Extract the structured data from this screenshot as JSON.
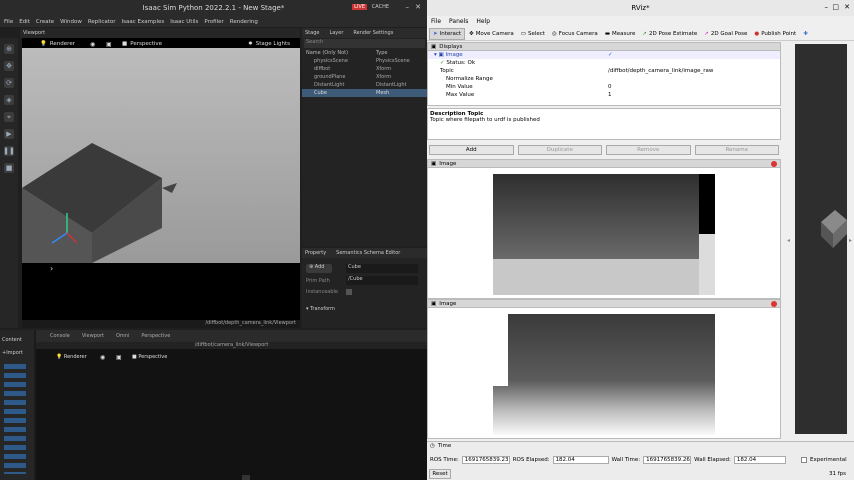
{
  "isaac": {
    "title": "Isaac Sim Python 2022.2.1 - New Stage*",
    "live": "LIVE",
    "cache": "CACHE",
    "menu": [
      "File",
      "Edit",
      "Create",
      "Window",
      "Replicator",
      "Isaac Examples",
      "Isaac Utils",
      "Profiler",
      "Rendering"
    ],
    "viewport_tab": "Viewport",
    "renderer_label": "Renderer",
    "perspective_label": "Perspective",
    "stage_lights_label": "Stage Lights",
    "viewport_path": "/diffbot/depth_camera_link/Viewport",
    "viewport2_tabs": [
      "Console",
      "Viewport",
      "Omni",
      "Perspective"
    ],
    "viewport2_path": "/diffbot/camera_link/Viewport",
    "stage_tabs": [
      "Stage",
      "Layer",
      "Render Settings"
    ],
    "search_placeholder": "Search",
    "stage_cols": [
      "Name (Only Not)",
      "Type"
    ],
    "stage_rows": [
      {
        "name": "physicsScene",
        "type": "PhysicsScene"
      },
      {
        "name": "diffbot",
        "type": "Xform"
      },
      {
        "name": "groundPlane",
        "type": "Xform"
      },
      {
        "name": "DistantLight",
        "type": "DistantLight"
      },
      {
        "name": "Cube",
        "type": "Mesh"
      }
    ],
    "property_tabs": [
      "Property",
      "Semantics Schema Editor"
    ],
    "add_label": "Add",
    "name_value": "Cube",
    "prim_path_label": "Prim Path",
    "prim_path_value": "/Cube",
    "instanceable_label": "Instanceable",
    "transform_label": "Transform",
    "content_label": "Content",
    "import_label": "Import"
  },
  "rviz": {
    "title": "RViz*",
    "menu": [
      "File",
      "Panels",
      "Help"
    ],
    "tools": [
      "Interact",
      "Move Camera",
      "Select",
      "Focus Camera",
      "Measure",
      "2D Pose Estimate",
      "2D Goal Pose",
      "Publish Point"
    ],
    "displays_title": "Displays",
    "props": [
      {
        "name": "Image",
        "value": "✓",
        "indent": 1
      },
      {
        "name": "Status: Ok",
        "value": "",
        "indent": 2
      },
      {
        "name": "Topic",
        "value": "/diffbot/depth_camera_link/image_raw",
        "indent": 2
      },
      {
        "name": "Normalize Range",
        "value": "",
        "indent": 2
      },
      {
        "name": "Min Value",
        "value": "0",
        "indent": 2
      },
      {
        "name": "Max Value",
        "value": "1",
        "indent": 2
      }
    ],
    "desc_title": "Description Topic",
    "desc_text": "Topic where filepath to urdf is published",
    "buttons": [
      "Add",
      "Duplicate",
      "Remove",
      "Rename"
    ],
    "image_panel_1": "Image",
    "image_panel_2": "Image",
    "time_title": "Time",
    "ros_time_label": "ROS Time:",
    "ros_time_value": "1691765839.23",
    "ros_elapsed_label": "ROS Elapsed:",
    "ros_elapsed_value": "182.04",
    "wall_time_label": "Wall Time:",
    "wall_time_value": "1691765839.26",
    "wall_elapsed_label": "Wall Elapsed:",
    "wall_elapsed_value": "182.04",
    "experimental_label": "Experimental",
    "reset_label": "Reset",
    "fps": "31 fps"
  }
}
